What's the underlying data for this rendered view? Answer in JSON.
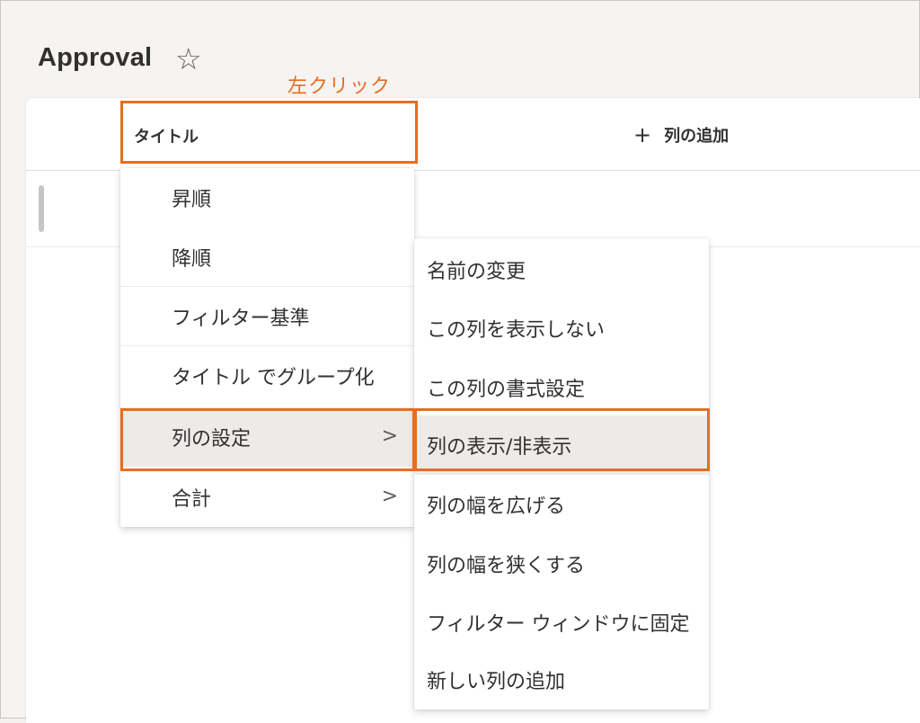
{
  "page": {
    "title": "Approval",
    "favorite_icon": "star-outline-icon"
  },
  "annotation": {
    "callout": "左クリック",
    "accent_color": "#e86d1f"
  },
  "header": {
    "title_column": "タイトル",
    "add_column_label": "列の追加",
    "add_icon": "plus-icon"
  },
  "column_menu": {
    "items": [
      {
        "label": "昇順"
      },
      {
        "label": "降順"
      },
      {
        "label": "フィルター基準"
      },
      {
        "label": "タイトル でグループ化"
      },
      {
        "label": "列の設定",
        "submenu": true,
        "active": true
      },
      {
        "label": "合計",
        "submenu": true
      }
    ]
  },
  "settings_submenu": {
    "items": [
      {
        "label": "名前の変更"
      },
      {
        "label": "この列を表示しない"
      },
      {
        "label": "この列の書式設定"
      },
      {
        "label": "列の表示/非表示",
        "active": true
      },
      {
        "label": "列の幅を広げる"
      },
      {
        "label": "列の幅を狭くする"
      },
      {
        "label": "フィルター ウィンドウに固定"
      },
      {
        "label": "新しい列の追加"
      }
    ]
  },
  "colors": {
    "accent": "#e86d1f",
    "menu_highlight": "#edebe9",
    "text": "#323130"
  }
}
